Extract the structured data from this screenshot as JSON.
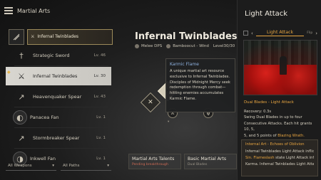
{
  "app": {
    "title": "Martial Arts"
  },
  "featured": {
    "label": "Infernal Twinblades"
  },
  "weapons": [
    {
      "name": "Strategic Sword",
      "level": "Lv. 46",
      "icon": "sword-icon"
    },
    {
      "name": "Infernal Twinblades",
      "level": "Lv. 30",
      "icon": "twinblades-icon",
      "active": true
    },
    {
      "name": "Heavenquaker Spear",
      "level": "Lv. 43",
      "icon": "spear-icon"
    },
    {
      "name": "Panacea Fan",
      "level": "Lv. 1",
      "icon": "fan-icon"
    },
    {
      "name": "Stormbreaker Spear",
      "level": "Lv. 1",
      "icon": "spear-icon"
    },
    {
      "name": "Inkwell Fan",
      "level": "Lv. 1",
      "icon": "fan-icon"
    }
  ],
  "filters": {
    "weapons": "All Weapons",
    "paths": "All Paths"
  },
  "center": {
    "title": "Infernal Twinblades",
    "role": "Melee DPS",
    "path": "Bamboocut - Wind",
    "level": "Level30/30"
  },
  "tooltip": {
    "title": "Karmic Flame",
    "body": "A unique martial art resource exclusive to Infernal Twinblades. Disciples of Midnight Mercy seek redemption through combat—hitting enemies accumulates Karmic Flame."
  },
  "cards": [
    {
      "title": "Martial Arts Talents",
      "sub": "Pending breakthrough",
      "accent": "#cf6b55"
    },
    {
      "title": "Basic Martial Arts",
      "sub": "Dual Blades",
      "accent": "#9d978a"
    }
  ],
  "right": {
    "title": "Light Attack",
    "tab_label": "Light Attack",
    "tab_hint": "Flip",
    "subtitle": "Dual Blades - Light Attack",
    "recovery": "Recovery: 0.3s",
    "desc_1": "Swing Dual Blades in up to four",
    "desc_2": "Consecutive Attacks. Each hit grants 10, 5,",
    "desc_3": "5, and 5 points of",
    "desc_hl": "Blazing Wrath.",
    "box_title": "Internal Art - Echoes of Oblivion",
    "box_l1a": "Infernal Twinblades Light Attack",
    "box_l1b": " inflicts",
    "box_l2a": "Sin. Flameslash",
    "box_l2b": " state ",
    "box_l2c": "Light Attack",
    "box_l2d": " inflicts",
    "box_l3": "Karma. Infernal Twinblades Light Attack"
  },
  "colors": {
    "accent": "#e6a440",
    "tooltip_title": "#8fb2e0",
    "alert": "#cf6b55"
  }
}
